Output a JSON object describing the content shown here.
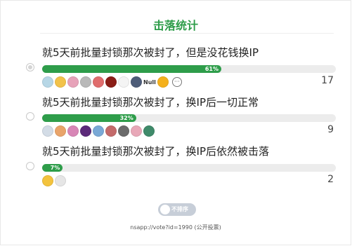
{
  "poll": {
    "title": "击落统计",
    "options": [
      {
        "label": "就5天前批量封锁那次被封了，但是没花钱换IP",
        "percent_text": "61%",
        "percent": 61,
        "count": "17",
        "selected": true,
        "voters": [
          {
            "name": "voter-avatar",
            "color": "#b7d7e6"
          },
          {
            "name": "voter-avatar",
            "color": "#f2c24a"
          },
          {
            "name": "voter-avatar",
            "color": "#e7a2b9"
          },
          {
            "name": "voter-avatar",
            "color": "#b9b9b9"
          },
          {
            "name": "voter-avatar",
            "color": "#e06d6d"
          },
          {
            "name": "voter-avatar",
            "color": "#8a1d16"
          },
          {
            "name": "voter-avatar",
            "color": "#f4f4f4"
          },
          {
            "name": "voter-avatar",
            "color": "#4e5d79"
          }
        ],
        "null_label": "Null",
        "extra_voters": [
          {
            "name": "voter-avatar",
            "color": "#f5b11c"
          }
        ],
        "more_glyph": "···"
      },
      {
        "label": "就5天前批量封锁那次被封了，换IP后一切正常",
        "percent_text": "32%",
        "percent": 32,
        "count": "9",
        "selected": false,
        "voters": [
          {
            "name": "voter-avatar",
            "color": "#d3dce6"
          },
          {
            "name": "voter-avatar",
            "color": "#e9a46a"
          },
          {
            "name": "voter-avatar",
            "color": "#d886b6"
          },
          {
            "name": "voter-avatar",
            "color": "#5c2a7a"
          },
          {
            "name": "voter-avatar",
            "color": "#7aa9d6"
          },
          {
            "name": "voter-avatar",
            "color": "#c46a6a"
          },
          {
            "name": "voter-avatar",
            "color": "#6b6b6b"
          },
          {
            "name": "voter-avatar",
            "color": "#e8a8b8"
          },
          {
            "name": "voter-avatar",
            "color": "#3f8a6a"
          }
        ]
      },
      {
        "label": "就5天前批量封锁那次被封了，换IP后依然被击落",
        "percent_text": "7%",
        "percent": 7,
        "count": "2",
        "selected": false,
        "voters": [
          {
            "name": "voter-avatar",
            "color": "#f3c33d"
          },
          {
            "name": "voter-avatar",
            "color": "#e6e6e6"
          }
        ]
      }
    ],
    "sort_toggle_label": "不排序",
    "footer": "nsapp://vote?id=1990 (公开投票)",
    "accent_color": "#2e9d4a"
  }
}
